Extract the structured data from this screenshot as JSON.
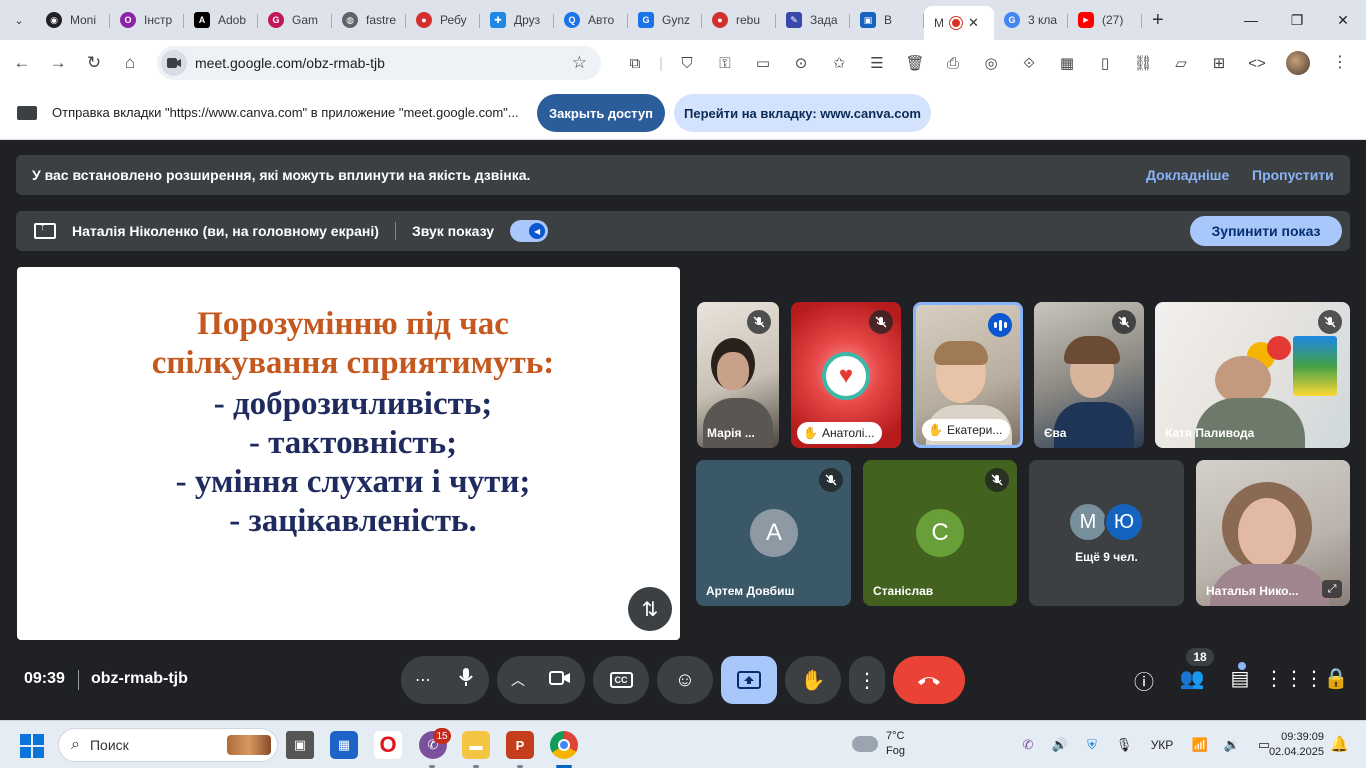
{
  "browser": {
    "tabs": [
      {
        "label": "Moni",
        "color": "#202124",
        "glyph": "◉"
      },
      {
        "label": "Інстр",
        "color": "#8e24aa",
        "glyph": "O"
      },
      {
        "label": "Adob",
        "color": "#000000",
        "glyph": "A"
      },
      {
        "label": "Gam",
        "color": "#c2185b",
        "glyph": "G"
      },
      {
        "label": "fastre",
        "color": "#5f6368",
        "glyph": "◍"
      },
      {
        "label": "Ребу",
        "color": "#d32f2f",
        "glyph": "●"
      },
      {
        "label": "Друз",
        "color": "#1e88e5",
        "glyph": "✚"
      },
      {
        "label": "Авто",
        "color": "#1a73e8",
        "glyph": "Q"
      },
      {
        "label": "Gynz",
        "color": "#1a73e8",
        "glyph": "G"
      },
      {
        "label": "rebu",
        "color": "#d32f2f",
        "glyph": "●"
      },
      {
        "label": "Зада",
        "color": "#3949ab",
        "glyph": "✎"
      },
      {
        "label": "В",
        "color": "#1565c0",
        "glyph": "▣"
      }
    ],
    "active_tab": {
      "label": "М"
    },
    "after_tabs": [
      {
        "label": "3 кла",
        "color": "#4285f4",
        "glyph": "G"
      },
      {
        "label": "(27)",
        "color": "#ff0000",
        "glyph": "▶"
      }
    ],
    "url": "meet.google.com/obz-rmab-tjb"
  },
  "share_notice": {
    "message": "Отправка вкладки \"https://www.canva.com\" в приложение \"meet.google.com\"...",
    "close_access": "Закрыть доступ",
    "go_to_tab": "Перейти на вкладку: www.canva.com"
  },
  "extension_banner": {
    "text": "У вас встановлено розширення, які можуть вплинути на якість дзвінка.",
    "learn_more": "Докладніше",
    "skip": "Пропустити"
  },
  "presenting": {
    "presenter": "Наталія Ніколенко (ви, на головному екрані)",
    "sound_label": "Звук показу",
    "stop_label": "Зупинити показ"
  },
  "slide": {
    "title_line1": "Порозумінню під час",
    "title_line2": "спілкування сприятимуть:",
    "line1": "- доброзичливість;",
    "line2": "- тактовність;",
    "line3": "- уміння слухати і чути;",
    "line4": "- зацікавленість."
  },
  "participants": {
    "maria": "Марія ...",
    "anatoly": "Анатолі...",
    "ekaterina": "Екатери...",
    "eva": "Єва",
    "katya": "Катя Паливода",
    "artem": {
      "name": "Артем Довбиш",
      "initial": "А"
    },
    "stanislav": {
      "name": "Станіслав",
      "initial": "С"
    },
    "more": {
      "initial1": "М",
      "initial2": "Ю",
      "text": "Ещё 9 чел."
    },
    "natalia": "Наталья Нико..."
  },
  "meeting": {
    "time": "09:39",
    "code": "obz-rmab-tjb",
    "participant_count": "18"
  },
  "taskbar": {
    "search_placeholder": "Поиск",
    "viber_badge": "15",
    "weather_temp": "7°C",
    "weather_desc": "Fog",
    "lang": "УКР",
    "time": "09:39:09",
    "date": "02.04.2025"
  },
  "colors": {
    "slide_title": "#c5581f",
    "slide_text": "#1f2a5e",
    "end_call": "#ea4335",
    "present_active": "#a8c7fa"
  }
}
